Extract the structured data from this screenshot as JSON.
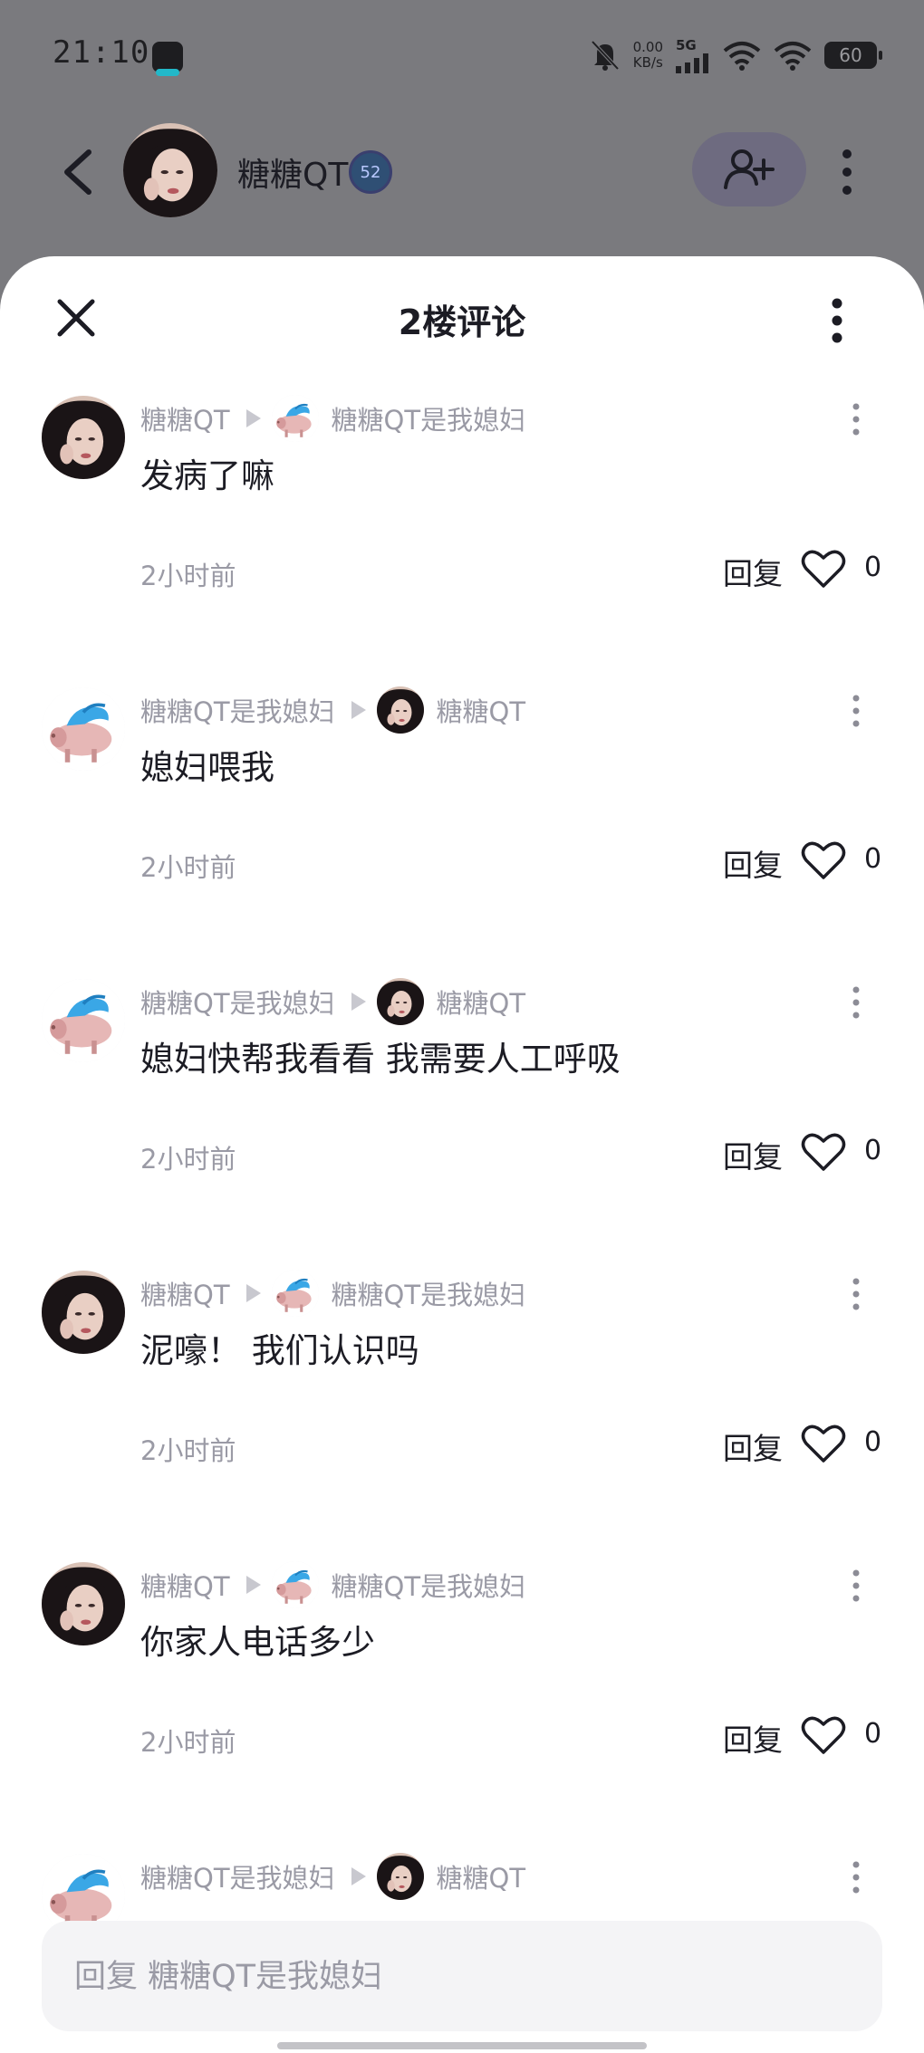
{
  "status_bar": {
    "time": "21:10",
    "net_speed_value": "0.00",
    "net_speed_unit": "KB/s",
    "signal_label": "5G",
    "battery": "60"
  },
  "chat_header": {
    "name": "糖糖QT",
    "level": "52"
  },
  "sheet": {
    "title": "2楼评论"
  },
  "comments": [
    {
      "author": "糖糖QT",
      "target": "糖糖QT是我媳妇",
      "author_avatar": "girl-avatar",
      "target_avatar": "pig-avatar",
      "text": "发病了嘛",
      "time": "2小时前",
      "reply_label": "回复",
      "likes": "0"
    },
    {
      "author": "糖糖QT是我媳妇",
      "target": "糖糖QT",
      "author_avatar": "pig-avatar",
      "target_avatar": "girl-avatar",
      "text": "媳妇喂我",
      "time": "2小时前",
      "reply_label": "回复",
      "likes": "0"
    },
    {
      "author": "糖糖QT是我媳妇",
      "target": "糖糖QT",
      "author_avatar": "pig-avatar",
      "target_avatar": "girl-avatar",
      "text": "媳妇快帮我看看 我需要人工呼吸",
      "time": "2小时前",
      "reply_label": "回复",
      "likes": "0"
    },
    {
      "author": "糖糖QT",
      "target": "糖糖QT是我媳妇",
      "author_avatar": "girl-avatar",
      "target_avatar": "pig-avatar",
      "text": "泥嚎！ 我们认识吗",
      "time": "2小时前",
      "reply_label": "回复",
      "likes": "0"
    },
    {
      "author": "糖糖QT",
      "target": "糖糖QT是我媳妇",
      "author_avatar": "girl-avatar",
      "target_avatar": "pig-avatar",
      "text": "你家人电话多少",
      "time": "2小时前",
      "reply_label": "回复",
      "likes": "0"
    },
    {
      "author": "糖糖QT是我媳妇",
      "target": "糖糖QT",
      "author_avatar": "pig-avatar",
      "target_avatar": "girl-avatar",
      "text": "",
      "time": "",
      "reply_label": "",
      "likes": ""
    }
  ],
  "reply_input": {
    "placeholder": "回复 糖糖QT是我媳妇",
    "value": ""
  },
  "colors": {
    "overlay": "#7a7a7e",
    "sheet_bg": "#ffffff",
    "meta_text": "#9a9aa5",
    "primary_text": "#1c1c24",
    "input_bg": "#f4f4f6"
  }
}
